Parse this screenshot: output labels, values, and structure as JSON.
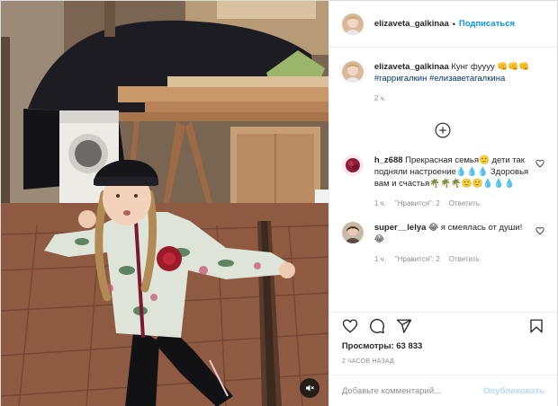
{
  "author": {
    "username": "elizaveta_galkinaa",
    "follow_label": "Подписаться",
    "separator": "•"
  },
  "caption": {
    "username": "elizaveta_galkinaa",
    "text": "Кунг фуууу 👊👊👊",
    "hashtags": [
      "#гарригалкин",
      "#елизаветагалкина"
    ],
    "time": "2 ч."
  },
  "comments": [
    {
      "username": "h_z688",
      "text": "Прекрасная семья🙂 дети так подняли настроение💧💧💧 Здоровья вам и счастья🌴🌴🌴🙂🙂💧💧💧",
      "time": "1 ч.",
      "likes": "\"Нравится\": 2",
      "reply": "Ответить"
    },
    {
      "username": "super__lelya",
      "text": "😂 я смеялась от души! 😂",
      "time": "1 ч.",
      "likes": "\"Нравится\": 2",
      "reply": "Ответить"
    }
  ],
  "stats": {
    "views": "Просмотры: 63 833",
    "ago": "2 часов назад"
  },
  "add_comment": {
    "placeholder": "Добавьте комментарий...",
    "publish_label": "Опубликовать"
  },
  "icons": {
    "mute": "speaker-muted-icon",
    "more_comments": "plus-circle-icon",
    "like": "heart-icon",
    "comment": "comment-bubble-icon",
    "share": "paper-plane-icon",
    "save": "bookmark-icon"
  },
  "colors": {
    "link_blue": "#0095f6",
    "hashtag": "#00376b",
    "muted_text": "#8e8e8e",
    "publish_disabled": "#b3dbff"
  }
}
